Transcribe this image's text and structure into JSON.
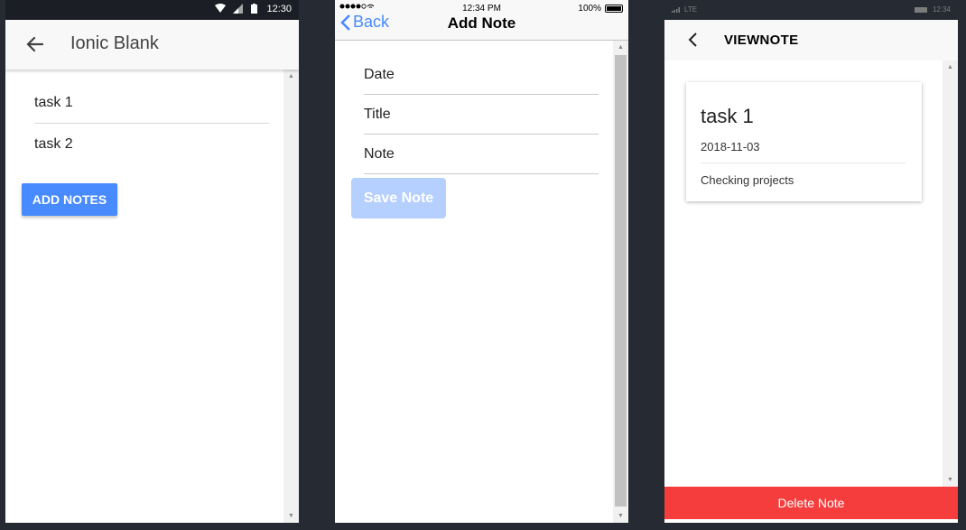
{
  "android": {
    "status_time": "12:30",
    "title": "Ionic Blank",
    "tasks": [
      "task 1",
      "task 2"
    ],
    "add_notes_label": "ADD NOTES",
    "icons": {
      "back": "arrow-left-icon",
      "wifi": "wifi-icon",
      "signal": "signal-icon",
      "battery": "battery-icon"
    }
  },
  "ios": {
    "status_time": "12:34 PM",
    "battery_pct": "100%",
    "back_label": "Back",
    "title": "Add Note",
    "fields": {
      "date": "Date",
      "title": "Title",
      "note": "Note"
    },
    "save_label": "Save Note",
    "save_enabled": false
  },
  "windows": {
    "status_time": "12:34",
    "status_network": "LTE",
    "title": "VIEWNOTE",
    "note": {
      "title": "task 1",
      "date": "2018-11-03",
      "body": "Checking projects"
    },
    "delete_label": "Delete Note"
  },
  "colors": {
    "primary": "#488aff",
    "danger": "#f53d3d",
    "background": "#262b33",
    "toolbar": "#f8f8f8"
  }
}
